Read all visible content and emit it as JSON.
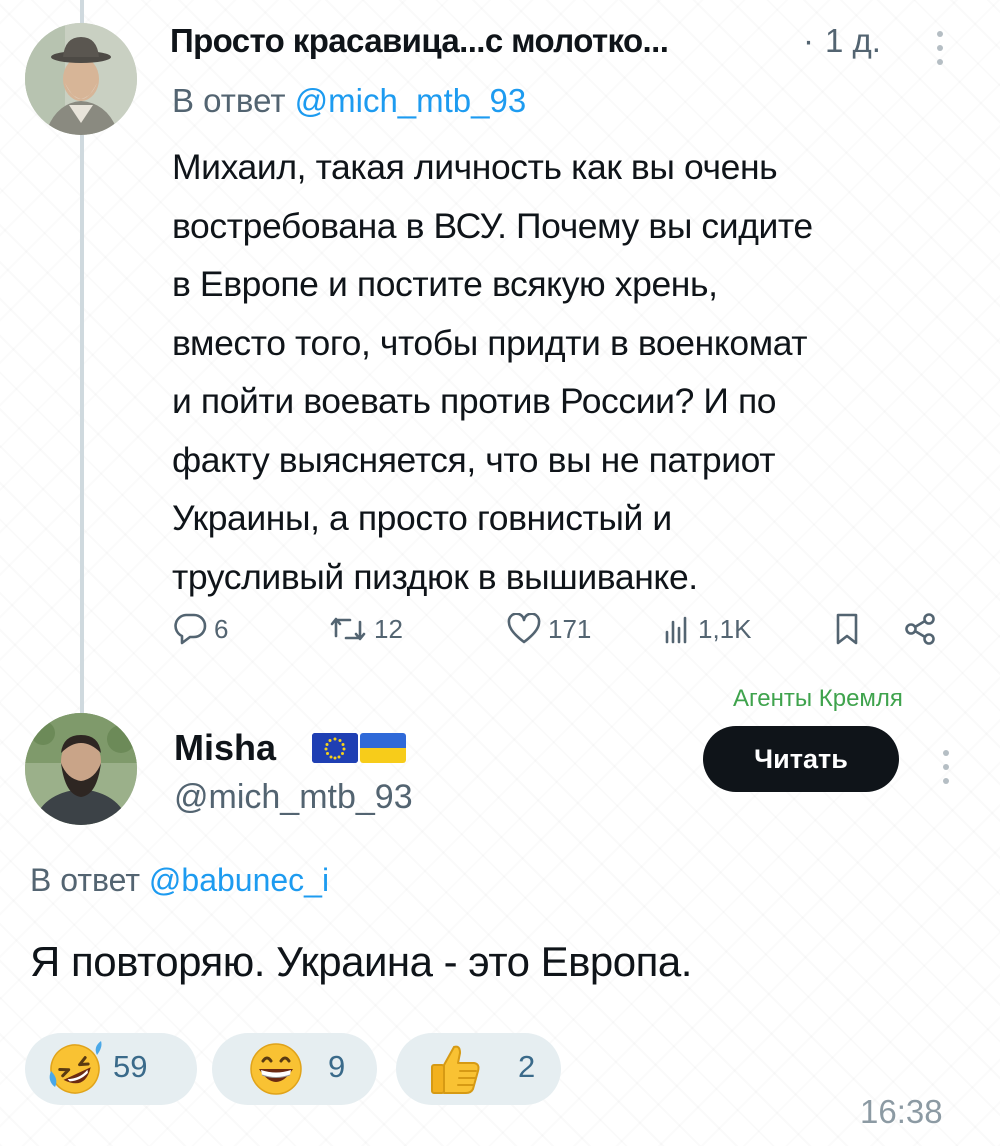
{
  "tweet": {
    "author_name": "Просто красавица...с молотко...",
    "separator": "·",
    "time": "1 д.",
    "reply_prefix": "В ответ ",
    "reply_handle": "@mich_mtb_93",
    "text_lines": [
      "Михаил, такая личность как вы очень",
      "востребована в ВСУ. Почему вы сидите",
      "в Европе и постите всякую хрень,",
      "вместо того, чтобы придти в военкомат",
      "и пойти воевать против России? И по",
      "факту выясняется, что вы не патриот",
      "Украины, а просто говнистый и",
      "трусливый пиздюк в вышиванке."
    ],
    "actions": {
      "replies": "6",
      "retweets": "12",
      "likes": "171",
      "views": "1,1K"
    }
  },
  "channel_label": "Агенты Кремля",
  "reply_tweet": {
    "author_name": "Misha",
    "handle": "@mich_mtb_93",
    "follow_label": "Читать",
    "reply_prefix": "В ответ ",
    "reply_handle": "@babunec_i",
    "text": "Я повторяю. Украина - это Европа."
  },
  "reactions": [
    {
      "emoji": "rolling-on-floor-laughing",
      "count": "59"
    },
    {
      "emoji": "grinning-face",
      "count": "9"
    },
    {
      "emoji": "thumbs-up",
      "count": "2"
    }
  ],
  "message_time": "16:38",
  "colors": {
    "link_blue": "#1d9bf0",
    "secondary_text": "#536471",
    "channel_green": "#3fa34d",
    "follow_button_bg": "#0f1419",
    "reaction_bg": "#e6eef1"
  }
}
